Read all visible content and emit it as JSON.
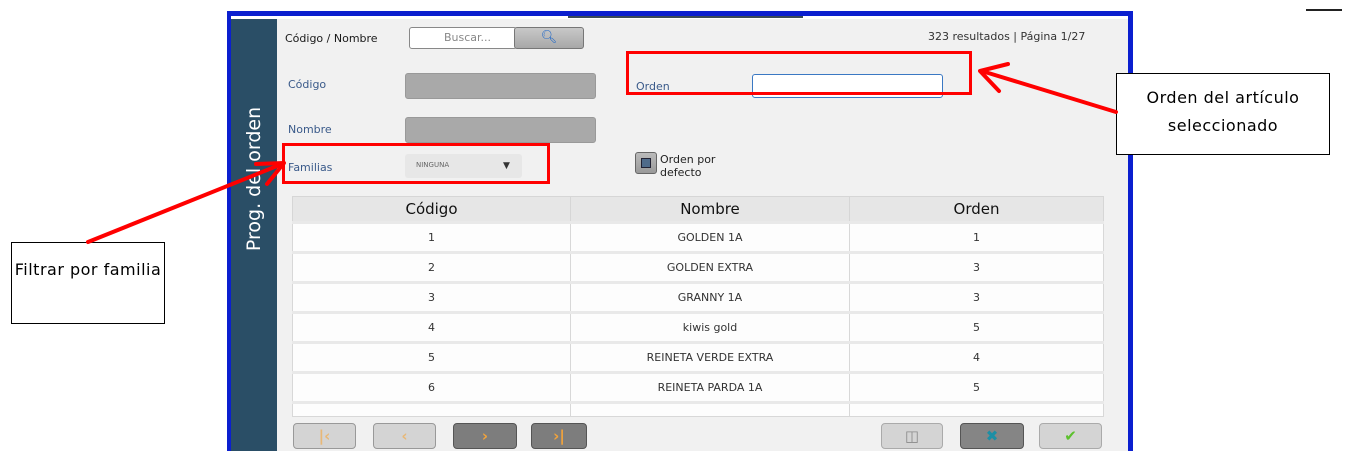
{
  "sidebar": {
    "title": "Prog. del orden"
  },
  "filter": {
    "code_name_label": "Código / Nombre",
    "search_placeholder": "Buscar...",
    "search_icon": "search-icon",
    "results_text": "323 resultados | Página 1/27"
  },
  "fields": {
    "codigo_label": "Código",
    "nombre_label": "Nombre",
    "orden_label": "Orden",
    "orden_value": "",
    "familias_label": "Familias",
    "familias_selected": "NINGUNA",
    "default_order_label": "Orden por defecto"
  },
  "table": {
    "columns": [
      "Código",
      "Nombre",
      "Orden"
    ],
    "rows": [
      [
        "1",
        "GOLDEN 1A",
        "1"
      ],
      [
        "2",
        "GOLDEN EXTRA",
        "3"
      ],
      [
        "3",
        "GRANNY 1A",
        "3"
      ],
      [
        "4",
        "kiwis gold",
        "5"
      ],
      [
        "5",
        "REINETA VERDE EXTRA",
        "4"
      ],
      [
        "6",
        "REINETA PARDA 1A",
        "5"
      ]
    ]
  },
  "pager": {
    "first_icon": "first-page-icon",
    "prev_icon": "prev-page-icon",
    "next_icon": "next-page-icon",
    "last_icon": "last-page-icon"
  },
  "actions": {
    "delete_icon": "trash-icon",
    "cancel_icon": "close-icon",
    "confirm_icon": "check-icon"
  },
  "annotations": {
    "orden_callout": "Orden del artículo seleccionado",
    "familia_callout": "Filtrar por familia"
  },
  "colors": {
    "frame_border": "#0b1fcf",
    "sidebar": "#2a4e66",
    "highlight": "#ff0000",
    "cancel_icon": "#1d8fa5",
    "confirm_icon": "#5cc12d"
  }
}
